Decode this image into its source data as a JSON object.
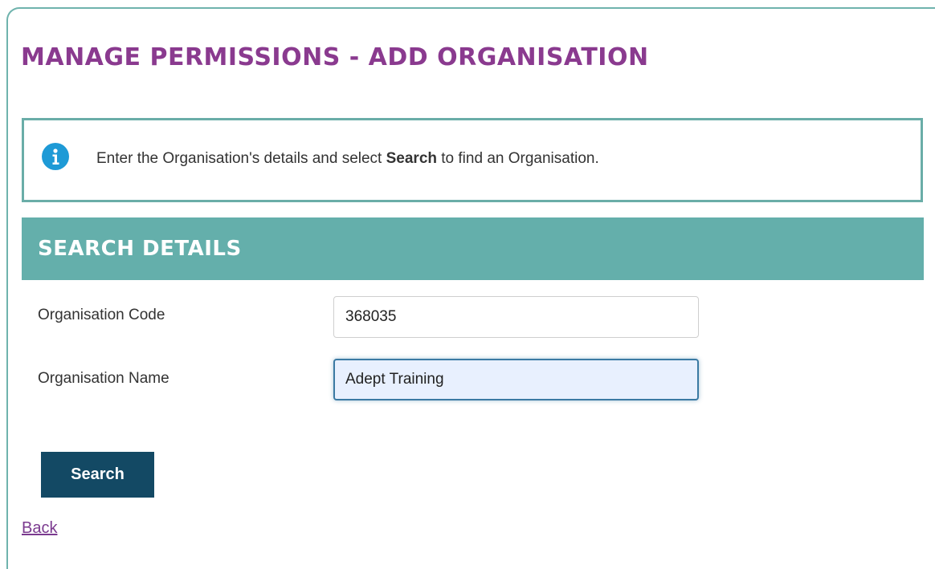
{
  "page": {
    "title": "MANAGE PERMISSIONS - ADD ORGANISATION"
  },
  "info": {
    "icon": "info-icon",
    "icon_color": "#1e9ad6",
    "text_before": "Enter the Organisation's details and select ",
    "text_bold": "Search",
    "text_after": " to find an Organisation."
  },
  "search_details": {
    "heading": "SEARCH DETAILS",
    "fields": [
      {
        "label": "Organisation Code",
        "value": "368035"
      },
      {
        "label": "Organisation Name",
        "value": "Adept Training"
      }
    ],
    "search_button_label": "Search"
  },
  "back_link_label": "Back",
  "colors": {
    "title": "#8a3a8f",
    "accent_teal": "#64afab",
    "button": "#134964",
    "link": "#7b3a8f"
  }
}
